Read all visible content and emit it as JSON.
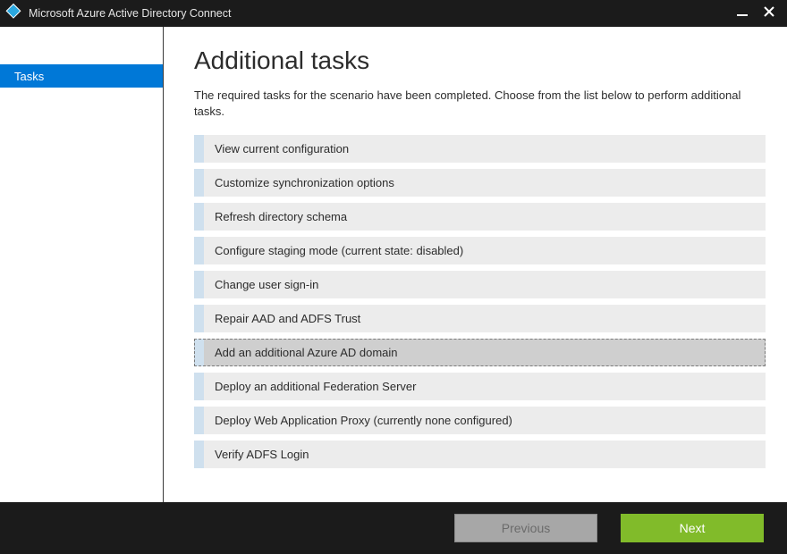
{
  "titlebar": {
    "title": "Microsoft Azure Active Directory Connect"
  },
  "sidebar": {
    "items": [
      {
        "label": "Tasks"
      }
    ]
  },
  "main": {
    "title": "Additional tasks",
    "description": "The required tasks for the scenario have been completed. Choose from the list below to perform additional tasks.",
    "tasks": [
      {
        "label": "View current configuration",
        "selected": false
      },
      {
        "label": "Customize synchronization options",
        "selected": false
      },
      {
        "label": "Refresh directory schema",
        "selected": false
      },
      {
        "label": "Configure staging mode (current state: disabled)",
        "selected": false
      },
      {
        "label": "Change user sign-in",
        "selected": false
      },
      {
        "label": "Repair AAD and ADFS Trust",
        "selected": false
      },
      {
        "label": "Add an additional Azure AD domain",
        "selected": true
      },
      {
        "label": "Deploy an additional Federation Server",
        "selected": false
      },
      {
        "label": "Deploy Web Application Proxy (currently none configured)",
        "selected": false
      },
      {
        "label": "Verify ADFS Login",
        "selected": false
      }
    ]
  },
  "footer": {
    "previous_label": "Previous",
    "next_label": "Next"
  }
}
